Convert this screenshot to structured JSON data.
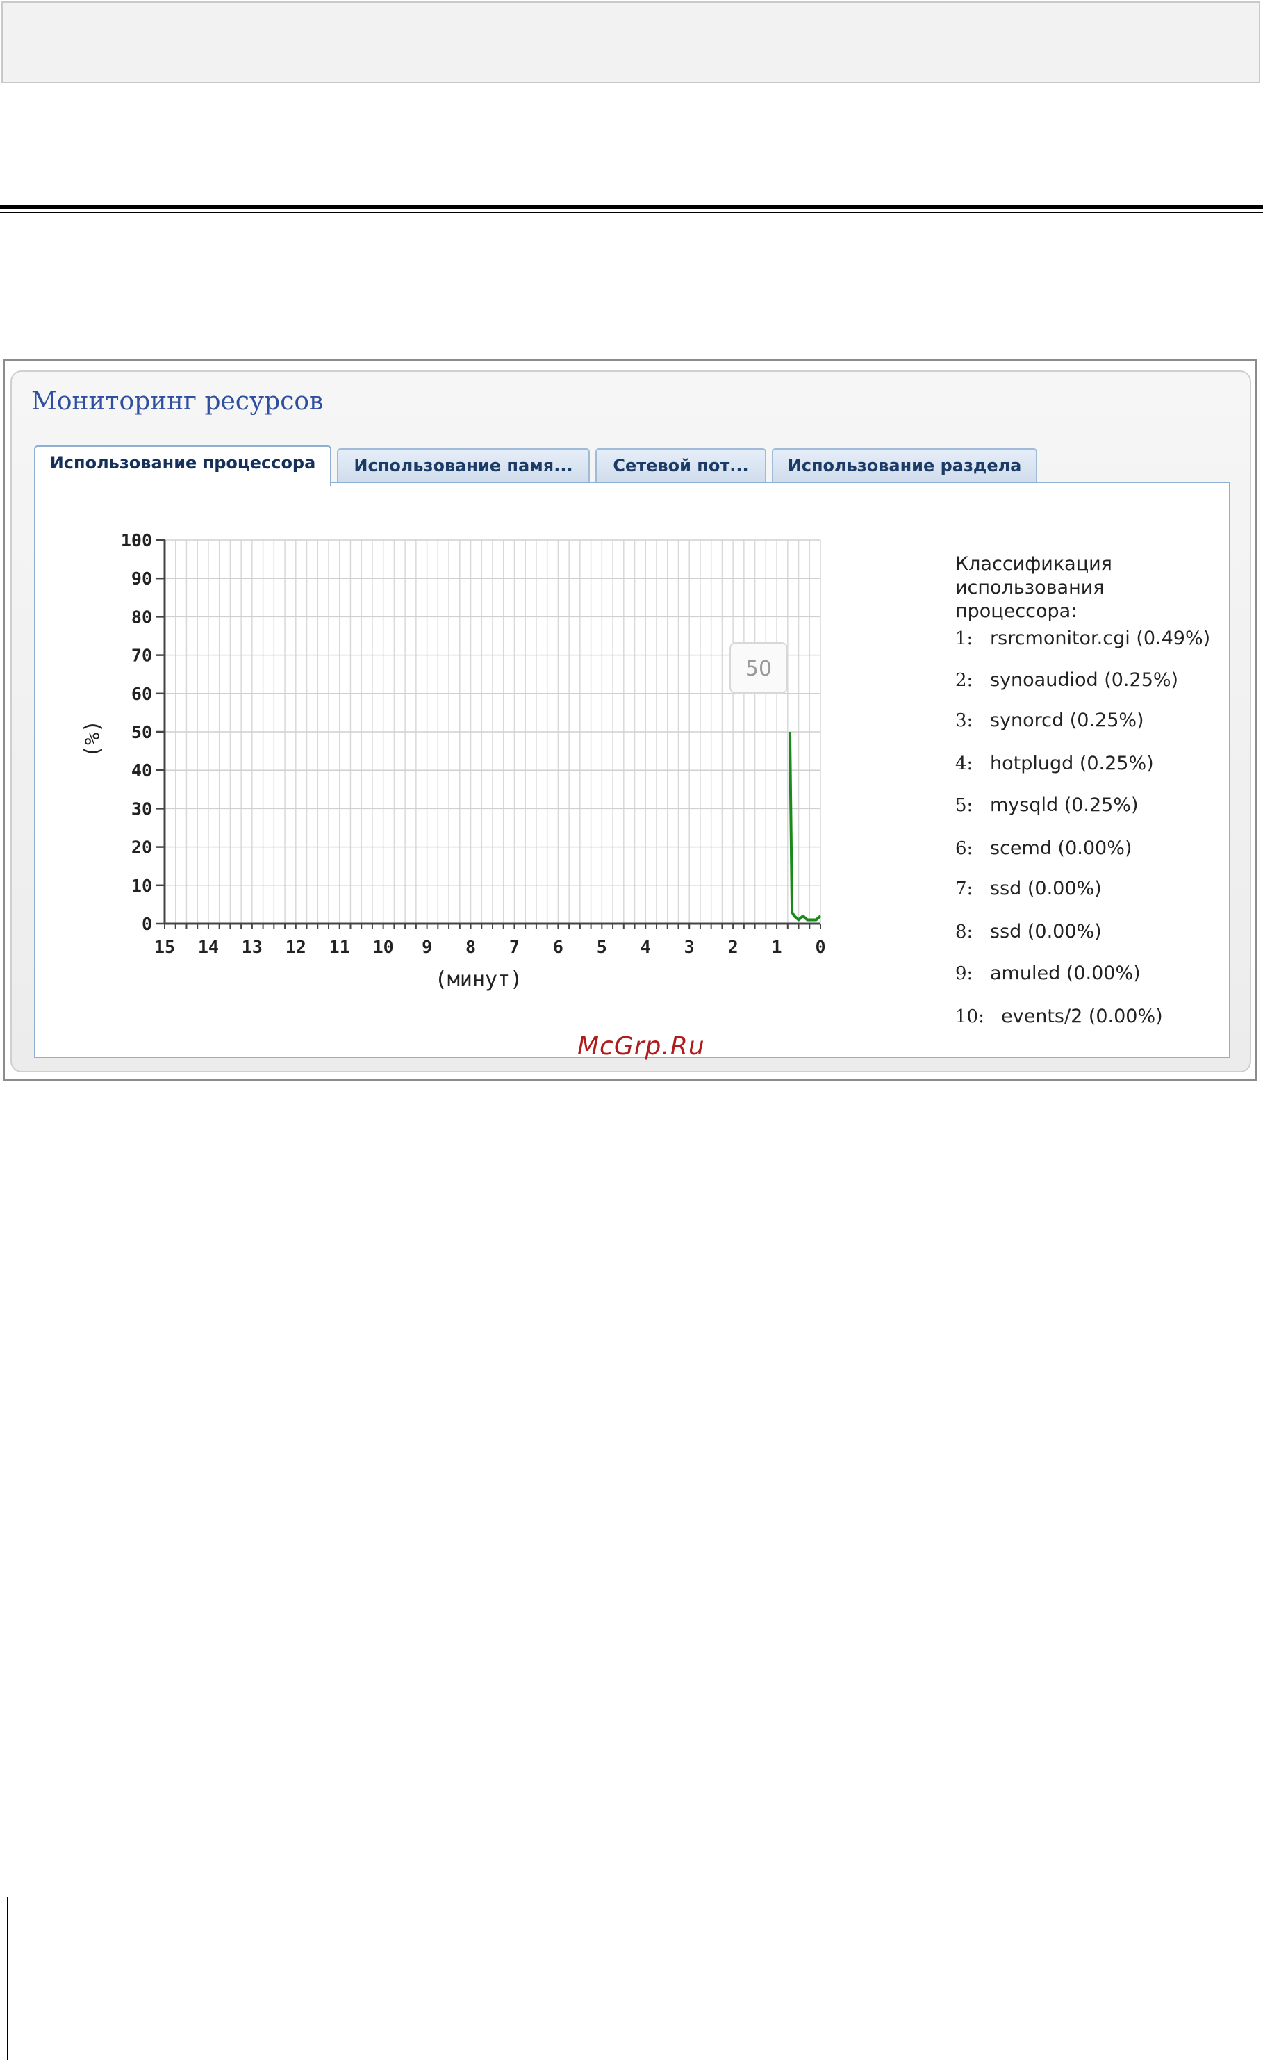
{
  "window": {
    "title": "Мониторинг ресурсов"
  },
  "tabs": [
    {
      "label": "Использование процессора",
      "active": true
    },
    {
      "label": "Использование памя...",
      "active": false
    },
    {
      "label": "Сетевой пот...",
      "active": false
    },
    {
      "label": "Использование раздела",
      "active": false
    }
  ],
  "chart_data": {
    "type": "line",
    "ylabel": "(%)",
    "xlabel": "(минут)",
    "ylim": [
      0,
      100
    ],
    "yticks": [
      0,
      10,
      20,
      30,
      40,
      50,
      60,
      70,
      80,
      90,
      100
    ],
    "xlim": [
      15,
      0
    ],
    "xticks": [
      15,
      14,
      13,
      12,
      11,
      10,
      9,
      8,
      7,
      6,
      5,
      4,
      3,
      2,
      1,
      0
    ],
    "grid": true,
    "series": [
      {
        "color": "#1a8a1a",
        "x": [
          0.7,
          0.65,
          0.6,
          0.5,
          0.4,
          0.3,
          0.2,
          0.1,
          0.0
        ],
        "y": [
          50,
          3,
          2,
          1,
          2,
          1,
          1,
          1,
          2
        ]
      }
    ],
    "tooltip": "50"
  },
  "legend": {
    "title": "Классификация использования процессора:",
    "items": [
      {
        "num": "1:",
        "text": "rsrcmonitor.cgi (0.49%)"
      },
      {
        "num": "2:",
        "text": "synoaudiod (0.25%)"
      },
      {
        "num": "3:",
        "text": "synorcd (0.25%)"
      },
      {
        "num": "4:",
        "text": "hotplugd (0.25%)"
      },
      {
        "num": "5:",
        "text": "mysqld (0.25%)"
      },
      {
        "num": "6:",
        "text": "scemd (0.00%)"
      },
      {
        "num": "7:",
        "text": "ssd (0.00%)"
      },
      {
        "num": "8:",
        "text": "ssd (0.00%)"
      },
      {
        "num": "9:",
        "text": "amuled (0.00%)"
      },
      {
        "num": "10:",
        "text": "events/2 (0.00%)"
      }
    ]
  },
  "watermark": "McGrp.Ru"
}
